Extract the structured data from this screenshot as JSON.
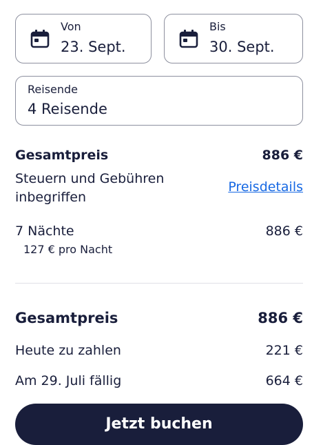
{
  "dates": {
    "from": {
      "label": "Von",
      "value": "23. Sept."
    },
    "to": {
      "label": "Bis",
      "value": "30. Sept."
    }
  },
  "travelers": {
    "label": "Reisende",
    "value": "4 Reisende"
  },
  "summary": {
    "total_label": "Gesamtpreis",
    "total_value": "886 €",
    "taxes_note_line1": "Steuern und Gebühren",
    "taxes_note_line2": "inbegriffen",
    "price_details_link": "Preisdetails",
    "nights_label": "7 Nächte",
    "nights_value": "886 €",
    "per_night": "127 € pro Nacht"
  },
  "payment": {
    "total_label": "Gesamtpreis",
    "total_value": "886 €",
    "today_label": "Heute zu zahlen",
    "today_value": "221 €",
    "due_label": "Am 29. Juli fällig",
    "due_value": "664 €"
  },
  "cta": {
    "label": "Jetzt buchen"
  },
  "colors": {
    "accent": "#191e3b",
    "link": "#1668e3",
    "border": "#8c8f9e"
  },
  "icons": [
    "calendar-icon"
  ]
}
